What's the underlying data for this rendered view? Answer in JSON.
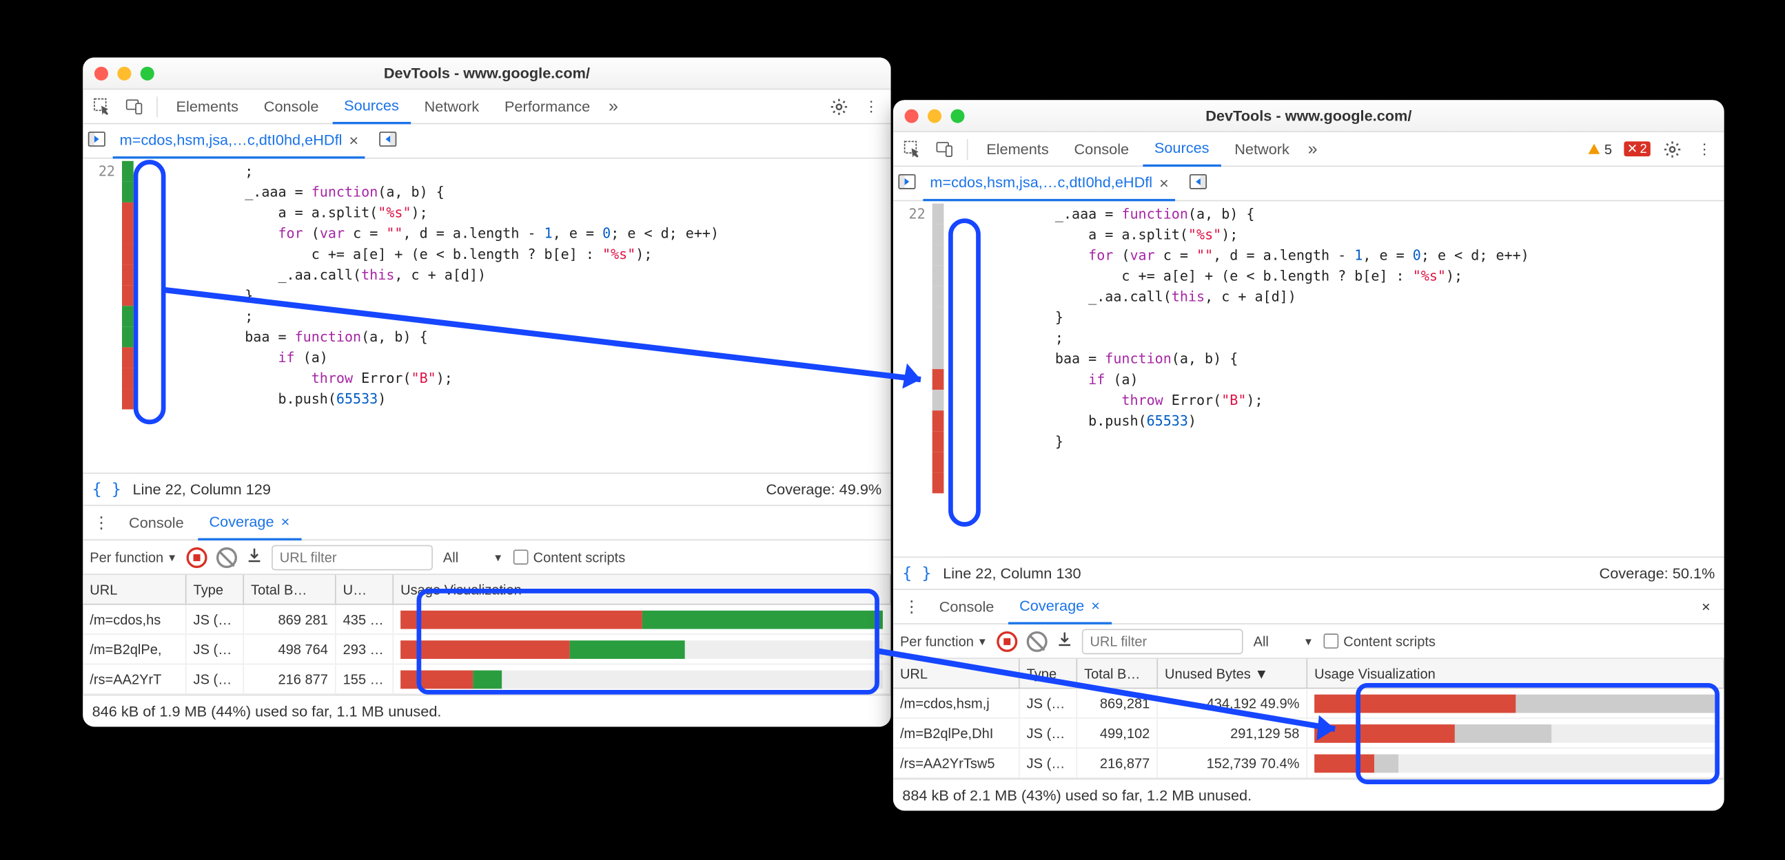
{
  "window1": {
    "title": "DevTools - www.google.com/",
    "tabs": [
      "Elements",
      "Console",
      "Sources",
      "Network",
      "Performance"
    ],
    "active_tab": "Sources",
    "file_tab": "m=cdos,hsm,jsa,…c,dtI0hd,eHDfl",
    "line_number": "22",
    "status_line": "Line 22, Column 129",
    "coverage_status": "Coverage: 49.9%",
    "drawer_tabs": [
      "Console",
      "Coverage"
    ],
    "drawer_active": "Coverage",
    "cov_toolbar": {
      "per": "Per function",
      "url_placeholder": "URL filter",
      "all": "All",
      "content_scripts": "Content scripts"
    },
    "columns": {
      "url": "URL",
      "type": "Type",
      "total": "Total B…",
      "unused": "U…",
      "usage": "Usage Visualization"
    },
    "rows": [
      {
        "url": "/m=cdos,hs",
        "type": "JS (…",
        "total": "869 281",
        "unused": "435 …",
        "red": 50,
        "green": 50
      },
      {
        "url": "/m=B2qlPe,",
        "type": "JS (…",
        "total": "498 764",
        "unused": "293 …",
        "red": 35,
        "green": 24
      },
      {
        "url": "/rs=AA2YrT",
        "type": "JS (…",
        "total": "216 877",
        "unused": "155 …",
        "red": 15,
        "green": 6
      }
    ],
    "summary": "846 kB of 1.9 MB (44%) used so far, 1.1 MB unused."
  },
  "window2": {
    "title": "DevTools - www.google.com/",
    "tabs": [
      "Elements",
      "Console",
      "Sources",
      "Network"
    ],
    "active_tab": "Sources",
    "warn_count": "5",
    "err_count": "2",
    "file_tab": "m=cdos,hsm,jsa,…c,dtI0hd,eHDfl",
    "line_number": "22",
    "status_line": "Line 22, Column 130",
    "coverage_status": "Coverage: 50.1%",
    "drawer_tabs": [
      "Console",
      "Coverage"
    ],
    "drawer_active": "Coverage",
    "cov_toolbar": {
      "per": "Per function",
      "url_placeholder": "URL filter",
      "all": "All",
      "content_scripts": "Content scripts"
    },
    "columns": {
      "url": "URL",
      "type": "Type",
      "total": "Total B…",
      "unused": "Unused Bytes ▼",
      "usage": "Usage Visualization"
    },
    "rows": [
      {
        "url": "/m=cdos,hsm,j",
        "type": "JS (…",
        "total": "869,281",
        "unused": "434,192  49.9%",
        "red": 50,
        "grey": 50
      },
      {
        "url": "/m=B2qlPe,DhI",
        "type": "JS (…",
        "total": "499,102",
        "unused": "291,129  58",
        "red": 35,
        "grey": 24
      },
      {
        "url": "/rs=AA2YrTsw5",
        "type": "JS (…",
        "total": "216,877",
        "unused": "152,739  70.4%",
        "red": 15,
        "grey": 6
      }
    ],
    "summary": "884 kB of 2.1 MB (43%) used so far, 1.2 MB unused."
  },
  "code": {
    "l1": "            ;",
    "l2": "            _.aaa = ",
    "l2b": "function",
    "l2c": "(a, b) {",
    "l3": "                a = a.split(",
    "l3s": "\"%s\"",
    "l3e": ");",
    "l4a": "                ",
    "l4f": "for",
    "l4b": " (",
    "l4v": "var",
    "l4c": " c = ",
    "l4s": "\"\"",
    "l4d": ", d = a.length - ",
    "l4n1": "1",
    "l4e": ", e = ",
    "l4n0": "0",
    "l4g": "; e < d; e++)",
    "l5a": "                    c += a[e] + (e < b.length ? b[e] : ",
    "l5s": "\"%s\"",
    "l5b": ");",
    "l6a": "                _.aa.call(",
    "l6t": "this",
    "l6b": ", c + a[d])",
    "l7": "            }",
    "l8": "            ;",
    "l9a": "            baa = ",
    "l9f": "function",
    "l9b": "(a, b) {",
    "l10a": "                ",
    "l10i": "if",
    "l10b": " (a)",
    "l11a": "                    ",
    "l11t": "throw",
    "l11b": " Error(",
    "l11s": "\"B\"",
    "l11c": ");",
    "l12a": "                b.push(",
    "l12n": "65533",
    "l12b": ")",
    "l13": "            }"
  }
}
